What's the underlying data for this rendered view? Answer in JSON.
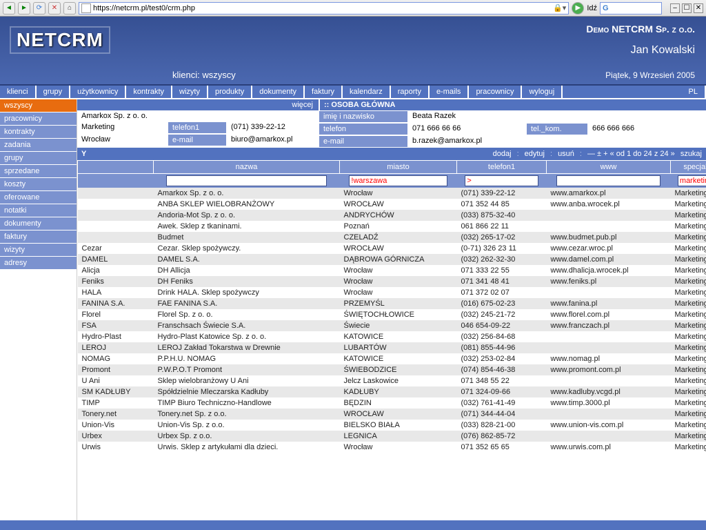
{
  "browser": {
    "url": "https://netcrm.pl/test0/crm.php",
    "go_label": "Idź"
  },
  "header": {
    "logo": "NETCRM",
    "firm": "Demo NETCRM Sp. z o.o.",
    "user": "Jan Kowalski",
    "subtitle": "klienci: wszyscy",
    "date": "Piątek, 9 Wrzesień 2005"
  },
  "menu": [
    "klienci",
    "grupy",
    "użytkownicy",
    "kontrakty",
    "wizyty",
    "produkty",
    "dokumenty",
    "faktury",
    "kalendarz",
    "raporty",
    "e-mails",
    "pracownicy",
    "wyloguj"
  ],
  "menu_right": "PL",
  "sidebar": [
    "wszyscy",
    "pracownicy",
    "kontrakty",
    "zadania",
    "grupy",
    "sprzedane",
    "koszty",
    "oferowane",
    "notatki",
    "dokumenty",
    "faktury",
    "wizyty",
    "adresy"
  ],
  "sidebar_active": 0,
  "detail_bar": {
    "more": "więcej",
    "osoba": ":: OSOBA GŁÓWNA"
  },
  "detail_left": {
    "company": "Amarkox Sp. z o. o.",
    "row1_a": "Marketing",
    "row1_lbl": "telefon1",
    "row1_b": "(071) 339-22-12",
    "row2_a": "Wrocław",
    "row2_lbl": "e-mail",
    "row2_b": "biuro@amarkox.pl"
  },
  "detail_right": {
    "row0_lbl": "imię i nazwisko",
    "row0_val": "Beata Razek",
    "row1_lbl": "telefon",
    "row1_val": "071 666 66 66",
    "row1_lbl2": "tel._kom.",
    "row1_val2": "666 666 666",
    "row2_lbl": "e-mail",
    "row2_val": "b.razek@amarkox.pl"
  },
  "toolbar": {
    "title": "Y",
    "actions": [
      "dodaj",
      "edytuj",
      "usuń"
    ],
    "pager": "— ± + « od 1 do 24 z 24 »",
    "search": "szukaj"
  },
  "columns": [
    "",
    "nazwa",
    "miasto",
    "telefon1",
    "www",
    "specjalizacja"
  ],
  "filters": {
    "nazwa": "",
    "miasto": "!warszawa",
    "telefon1": ">",
    "www": "",
    "specjalizacja": "marketing"
  },
  "rows": [
    {
      "short": "",
      "nazwa": "Amarkox Sp. z o. o.",
      "miasto": "Wrocław",
      "telefon": "(071) 339-22-12",
      "www": "www.amarkox.pl",
      "spec": "Marketing"
    },
    {
      "short": "",
      "nazwa": "ANBA SKLEP WIELOBRANŻOWY",
      "miasto": "WROCŁAW",
      "telefon": "071 352 44 85",
      "www": "www.anba.wrocek.pl",
      "spec": "Marketing"
    },
    {
      "short": "",
      "nazwa": "Andoria-Mot Sp. z o. o.",
      "miasto": "ANDRYCHÓW",
      "telefon": "(033) 875-32-40",
      "www": "",
      "spec": "Marketing"
    },
    {
      "short": "",
      "nazwa": "Awek. Sklep z tkaninami.",
      "miasto": "Poznań",
      "telefon": "061 866 22 11",
      "www": "",
      "spec": "Marketing"
    },
    {
      "short": "",
      "nazwa": "Budmet",
      "miasto": "CZELADŹ",
      "telefon": "(032) 265-17-02",
      "www": "www.budmet.pub.pl",
      "spec": "Marketing"
    },
    {
      "short": "Cezar",
      "nazwa": "Cezar. Sklep spożywczy.",
      "miasto": "WROCŁAW",
      "telefon": "(0-71) 326 23 11",
      "www": "www.cezar.wroc.pl",
      "spec": "Marketing"
    },
    {
      "short": "DAMEL",
      "nazwa": "DAMEL S.A.",
      "miasto": "DĄBROWA GÓRNICZA",
      "telefon": "(032) 262-32-30",
      "www": "www.damel.com.pl",
      "spec": "Marketing"
    },
    {
      "short": "Alicja",
      "nazwa": "DH Allicja",
      "miasto": "Wrocław",
      "telefon": "071 333 22 55",
      "www": "www.dhalicja.wrocek.pl",
      "spec": "Marketing"
    },
    {
      "short": "Feniks",
      "nazwa": "DH Feniks",
      "miasto": "Wrocław",
      "telefon": "071 341 48 41",
      "www": "www.feniks.pl",
      "spec": "Marketing"
    },
    {
      "short": "HALA",
      "nazwa": "Drink HALA. Sklep spożywczy",
      "miasto": "Wrocław",
      "telefon": "071 372 02 07",
      "www": "",
      "spec": "Marketing"
    },
    {
      "short": "FANINA S.A.",
      "nazwa": "FAE FANINA S.A.",
      "miasto": "PRZEMYŚL",
      "telefon": "(016) 675-02-23",
      "www": "www.fanina.pl",
      "spec": "Marketing"
    },
    {
      "short": "Florel",
      "nazwa": "Florel Sp. z o. o.",
      "miasto": "ŚWIĘTOCHŁOWICE",
      "telefon": "(032) 245-21-72",
      "www": "www.florel.com.pl",
      "spec": "Marketing"
    },
    {
      "short": "FSA",
      "nazwa": "Franschsach Świecie S.A.",
      "miasto": "Świecie",
      "telefon": "046 654-09-22",
      "www": "www.franczach.pl",
      "spec": "Marketing"
    },
    {
      "short": "Hydro-Plast",
      "nazwa": "Hydro-Plast Katowice Sp. z o. o.",
      "miasto": "KATOWICE",
      "telefon": "(032) 256-84-68",
      "www": "",
      "spec": "Marketing"
    },
    {
      "short": "LEROJ",
      "nazwa": "LEROJ Zakład Tokarstwa w Drewnie",
      "miasto": "LUBARTÓW",
      "telefon": "(081) 855-44-96",
      "www": "",
      "spec": "Marketing"
    },
    {
      "short": "NOMAG",
      "nazwa": "P.P.H.U. NOMAG",
      "miasto": "KATOWICE",
      "telefon": "(032) 253-02-84",
      "www": "www.nomag.pl",
      "spec": "Marketing"
    },
    {
      "short": "Promont",
      "nazwa": "P.W.P.O.T Promont",
      "miasto": "ŚWIEBODZICE",
      "telefon": "(074) 854-46-38",
      "www": "www.promont.com.pl",
      "spec": "Marketing"
    },
    {
      "short": "U Ani",
      "nazwa": "Sklep wielobranżowy U Ani",
      "miasto": "Jelcz Laskowice",
      "telefon": "071 348 55 22",
      "www": "",
      "spec": "Marketing"
    },
    {
      "short": "SM KADŁUBY",
      "nazwa": "Spółdzielnie Mleczarska Kadłuby",
      "miasto": "KADŁUBY",
      "telefon": "071 324-09-66",
      "www": "www.kadluby.vcgd.pl",
      "spec": "Marketing"
    },
    {
      "short": "TIMP",
      "nazwa": "TIMP Biuro Techniczno-Handlowe",
      "miasto": "BĘDZIN",
      "telefon": "(032) 761-41-49",
      "www": "www.timp.3000.pl",
      "spec": "Marketing"
    },
    {
      "short": "Tonery.net",
      "nazwa": "Tonery.net Sp. z o.o.",
      "miasto": "WROCŁAW",
      "telefon": "(071) 344-44-04",
      "www": "",
      "spec": "Marketing"
    },
    {
      "short": "Union-Vis",
      "nazwa": "Union-Vis Sp. z o.o.",
      "miasto": "BIELSKO BIAŁA",
      "telefon": "(033) 828-21-00",
      "www": "www.union-vis.com.pl",
      "spec": "Marketing"
    },
    {
      "short": "Urbex",
      "nazwa": "Urbex Sp. z o.o.",
      "miasto": "LEGNICA",
      "telefon": "(076) 862-85-72",
      "www": "",
      "spec": "Marketing"
    },
    {
      "short": "Urwis",
      "nazwa": "Urwis. Sklep z artykułami dla dzieci.",
      "miasto": "Wrocław",
      "telefon": "071 352 65 65",
      "www": "www.urwis.com.pl",
      "spec": "Marketing"
    }
  ]
}
